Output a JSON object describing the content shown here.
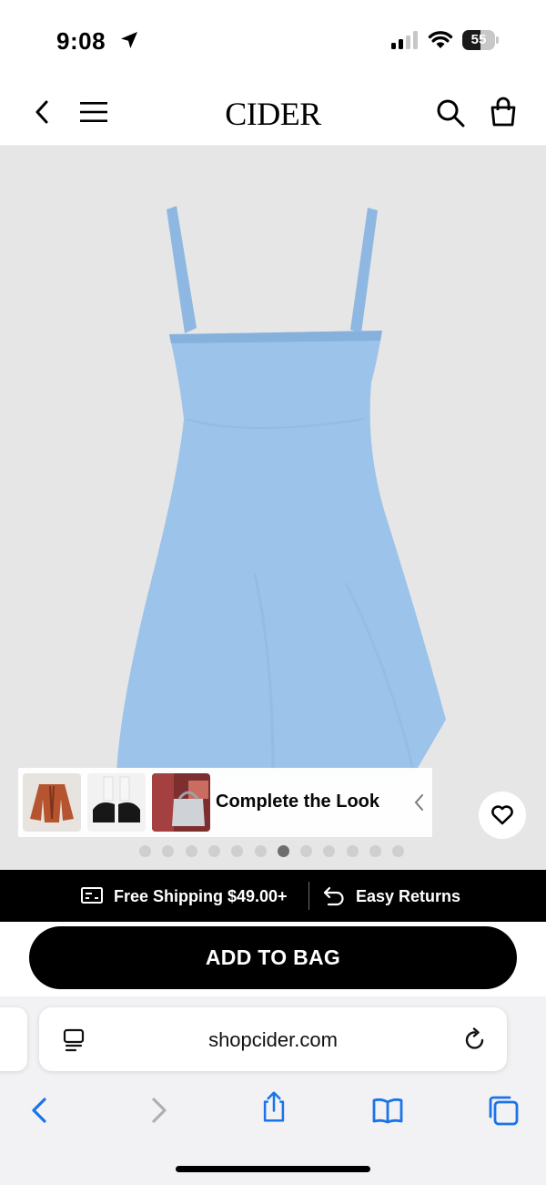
{
  "status_bar": {
    "time": "9:08",
    "battery_level": "55",
    "icons": [
      "location-arrow-icon",
      "cellular-signal-icon",
      "wifi-icon",
      "battery-icon"
    ]
  },
  "header": {
    "brand": "CIDER",
    "icons": [
      "back-chevron-icon",
      "hamburger-menu-icon",
      "search-icon",
      "shopping-bag-icon"
    ]
  },
  "gallery": {
    "product_color": "#9cc3ea",
    "image_count": 12,
    "active_image_index": 6,
    "complete_the_look": {
      "label": "Complete the Look",
      "thumbnails": [
        "jacket-thumbnail",
        "mary-jane-shoes-thumbnail",
        "handbag-thumbnail"
      ]
    }
  },
  "promo": {
    "shipping_text": "Free Shipping $49.00+",
    "returns_text": "Easy Returns"
  },
  "cta": {
    "add_to_bag_label": "ADD TO BAG"
  },
  "browser": {
    "url": "shopcider.com",
    "accent_color": "#1a73e8",
    "toolbar_icons": [
      "back-icon",
      "forward-icon",
      "share-icon",
      "bookmarks-icon",
      "tabs-icon"
    ]
  }
}
